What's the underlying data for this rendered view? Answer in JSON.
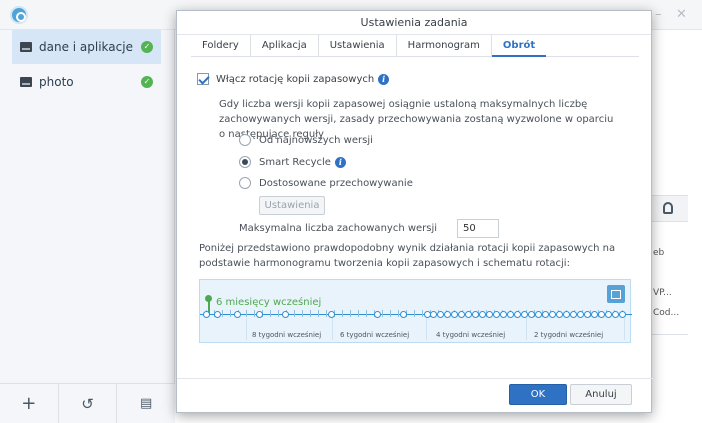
{
  "sidebar": {
    "tasks": [
      {
        "label": "dane i aplikacje",
        "status_icon": "check-circle-icon"
      },
      {
        "label": "photo",
        "status_icon": "check-circle-icon"
      }
    ],
    "bottom_icons": [
      "plus-icon",
      "history-icon",
      "document-icon"
    ]
  },
  "right_panel": {
    "lines": [
      "eb",
      "VP...",
      "Cod..."
    ]
  },
  "dialog": {
    "title": "Ustawienia zadania",
    "tabs": [
      "Foldery",
      "Aplikacja",
      "Ustawienia",
      "Harmonogram",
      "Obrót"
    ],
    "active_tab": "Obrót",
    "enable_rotation_label": "Włącz rotację kopii zapasowych",
    "enable_rotation_checked": true,
    "description": "Gdy liczba wersji kopii zapasowej osiągnie ustaloną maksymalnych liczbę zachowywanych wersji, zasady przechowywania zostaną wyzwolone w oparciu o następujące reguły",
    "options": [
      {
        "label": "Od najnowszych wersji",
        "selected": false
      },
      {
        "label": "Smart Recycle",
        "selected": true
      },
      {
        "label": "Dostosowane przechowywanie",
        "selected": false
      }
    ],
    "settings_button": "Ustawienia",
    "max_versions_label": "Maksymalna liczba zachowanych wersji",
    "max_versions_value": "50",
    "preview_text": "Poniżej przedstawiono prawdopodobny wynik działania rotacji kopii zapasowych na podstawie harmonogramu tworzenia kopii zapasowych i schematu rotacji:",
    "timeline": {
      "now_label": "6 miesięcy wcześniej",
      "week_labels": [
        "8 tygodni wcześniej",
        "6 tygodni wcześniej",
        "4 tygodni wcześniej",
        "2 tygodni wcześniej"
      ]
    },
    "ok_button": "OK",
    "cancel_button": "Anuluj"
  },
  "colors": {
    "accent": "#2f72c4",
    "success": "#54b454",
    "timeline_bg": "#e8f3fb"
  }
}
